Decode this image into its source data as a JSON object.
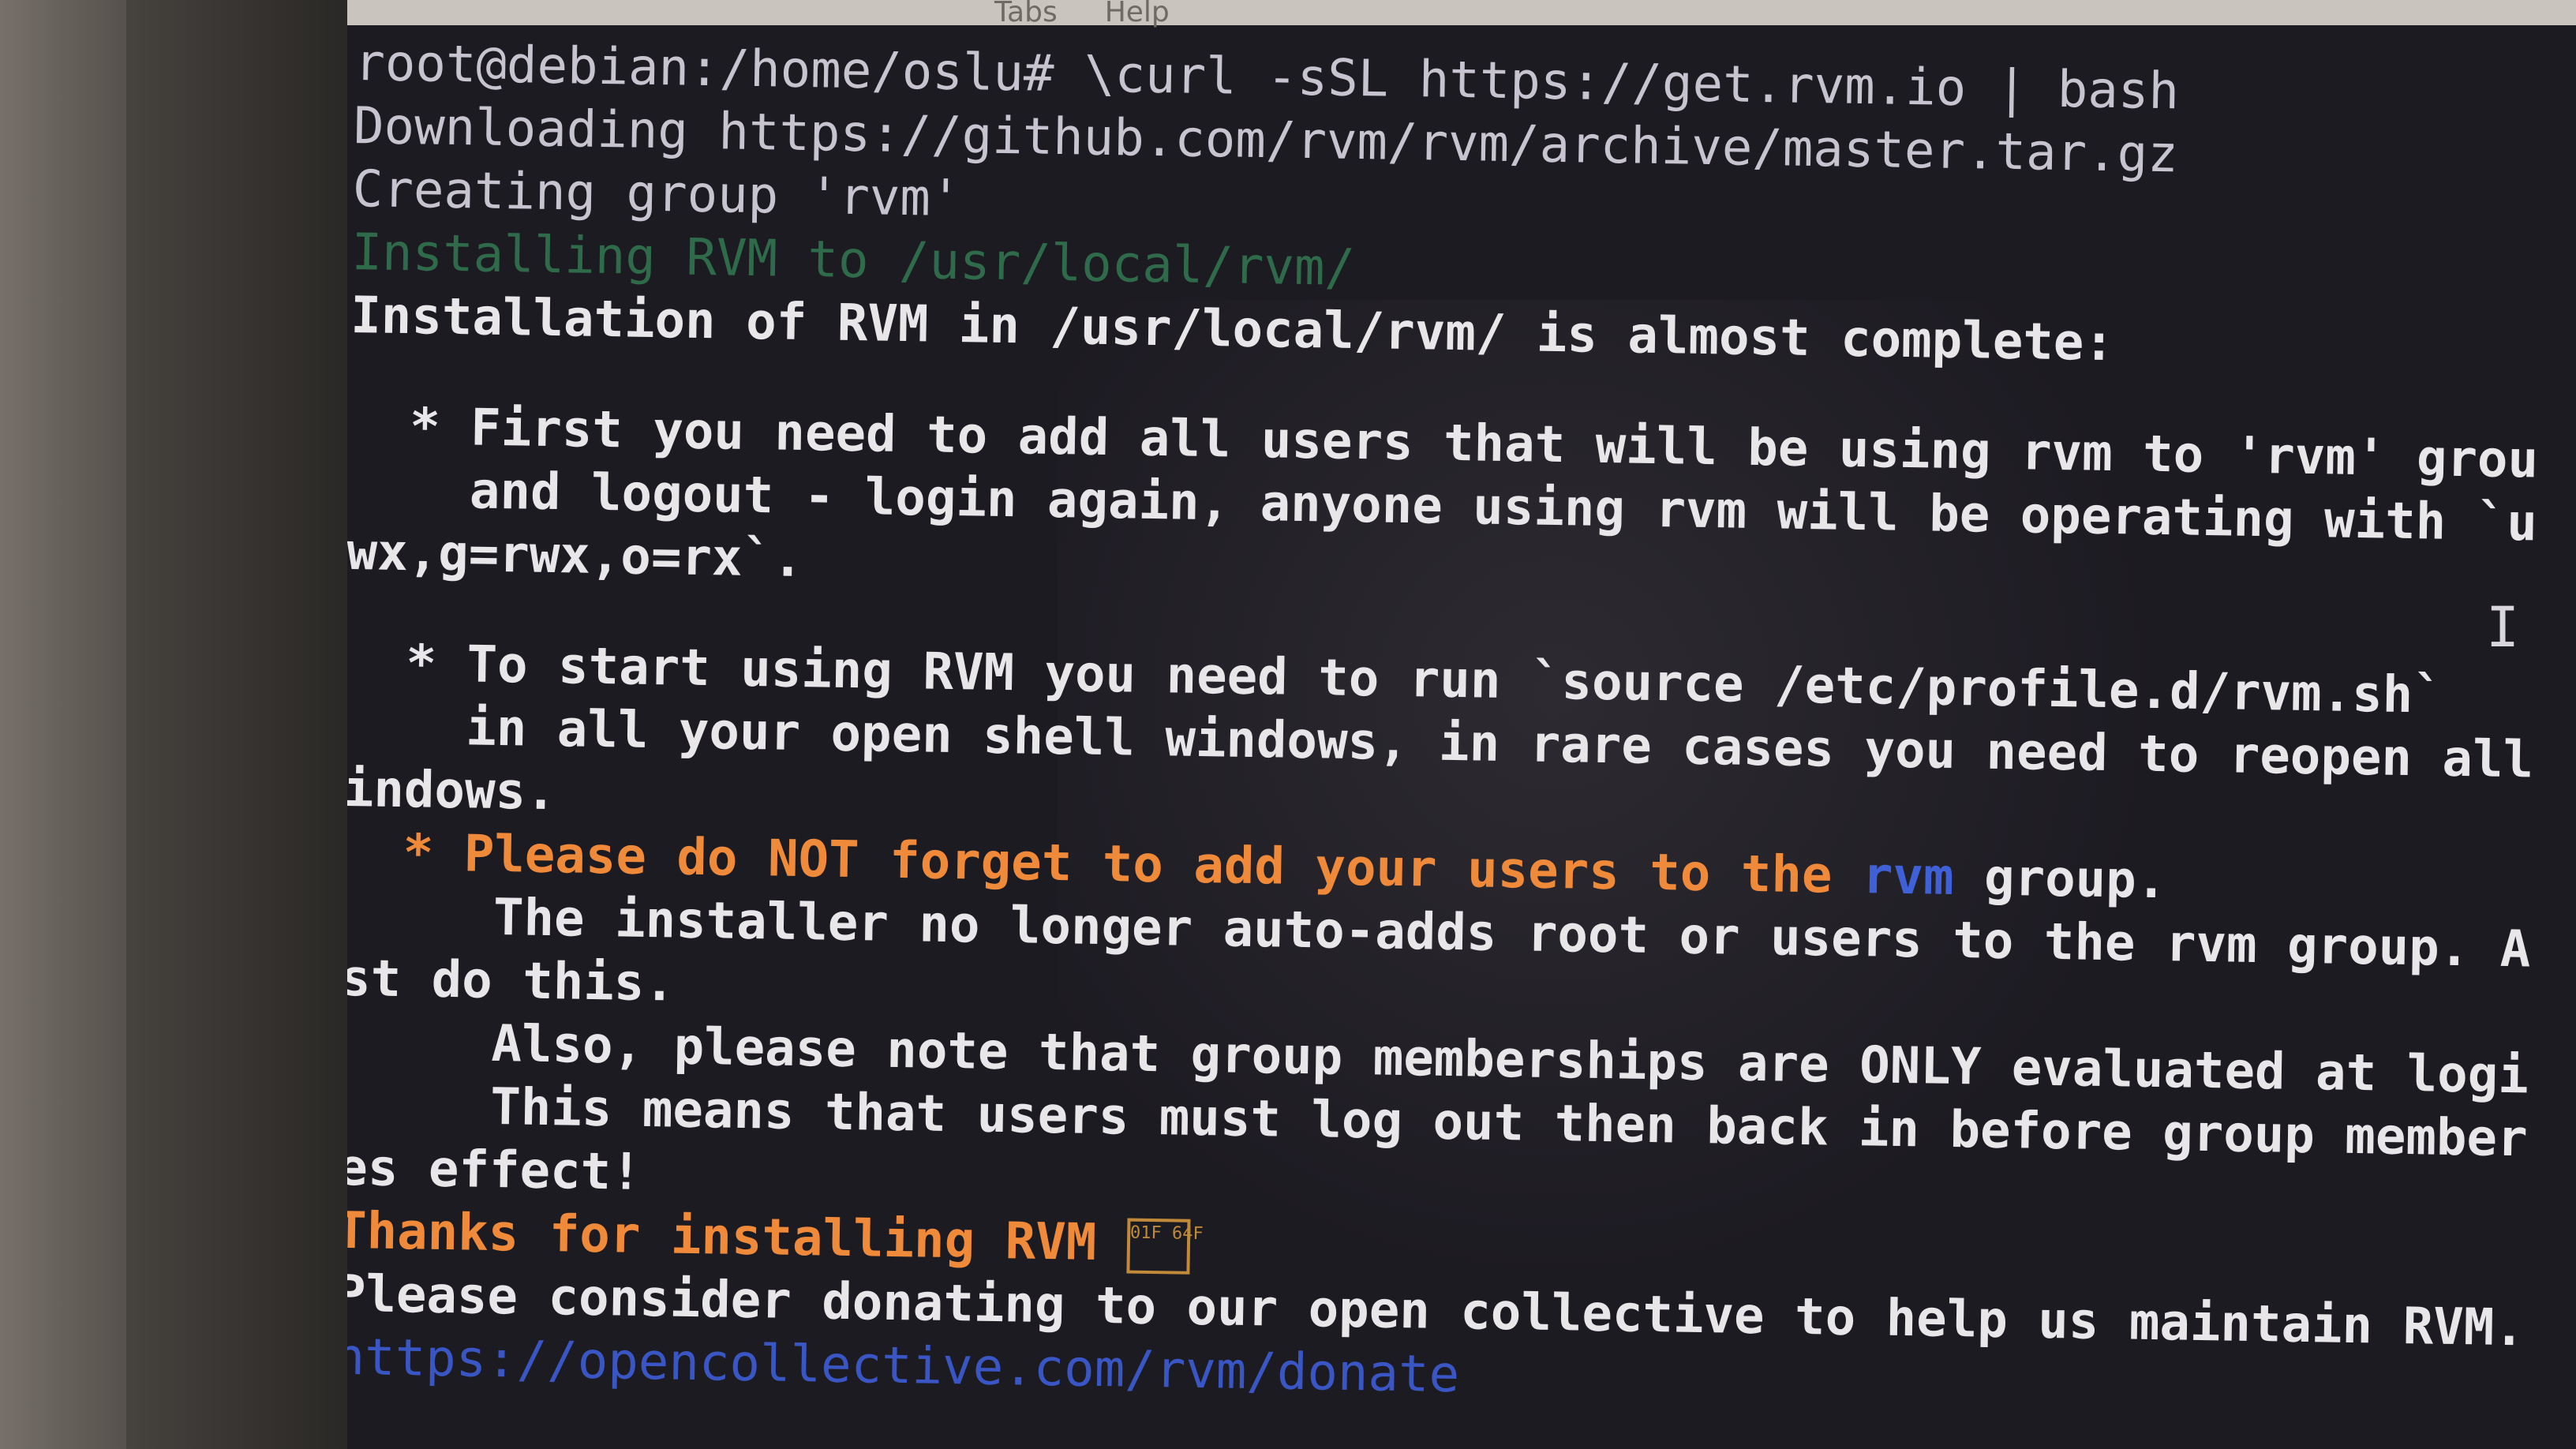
{
  "menubar": {
    "items": [
      "Tabs",
      "Help"
    ]
  },
  "terminal": {
    "lines": [
      {
        "text": "root@debian:/home/oslu# \\curl -sSL https://get.rvm.io | bash",
        "style": "dim"
      },
      {
        "text": "Downloading https://github.com/rvm/rvm/archive/master.tar.gz",
        "style": "dim"
      },
      {
        "text": "Creating group 'rvm'",
        "style": "dim"
      },
      {
        "text": "Installing RVM to /usr/local/rvm/",
        "style": "faded"
      },
      {
        "text": "Installation of RVM in /usr/local/rvm/ is almost complete:",
        "style": "normal"
      },
      {
        "text": "",
        "style": "blank"
      },
      {
        "text": "  * First you need to add all users that will be using rvm to 'rvm' grou",
        "style": "normal"
      },
      {
        "text": "    and logout - login again, anyone using rvm will be operating with `u",
        "style": "normal"
      },
      {
        "text": "wx,g=rwx,o=rx`.",
        "style": "normal"
      },
      {
        "text": "",
        "style": "blank"
      },
      {
        "text": "  * To start using RVM you need to run `source /etc/profile.d/rvm.sh`",
        "style": "normal"
      },
      {
        "text": "    in all your open shell windows, in rare cases you need to reopen all",
        "style": "normal"
      },
      {
        "text": "indows.",
        "style": "normal"
      }
    ],
    "warning_prefix": "  * Please do NOT forget to add your users to the ",
    "warning_group": "rvm",
    "warning_suffix": " group.",
    "lines_after": [
      {
        "text": "     The installer no longer auto-adds root or users to the rvm group. A",
        "style": "normal"
      },
      {
        "text": "st do this.",
        "style": "normal"
      },
      {
        "text": "     Also, please note that group memberships are ONLY evaluated at logi",
        "style": "normal"
      },
      {
        "text": "     This means that users must log out then back in before group member",
        "style": "normal"
      },
      {
        "text": "es effect!",
        "style": "normal"
      }
    ],
    "thanks": "Thanks for installing RVM ",
    "emoji_code": "01F 64F",
    "donate": "Please consider donating to our open collective to help us maintain RVM.",
    "donate_link": "https://opencollective.com/rvm/donate"
  },
  "colors": {
    "text": "#e9e6ea",
    "warning": "#f08a3b",
    "group_highlight": "#4060d8",
    "background": "#1d1b22"
  }
}
